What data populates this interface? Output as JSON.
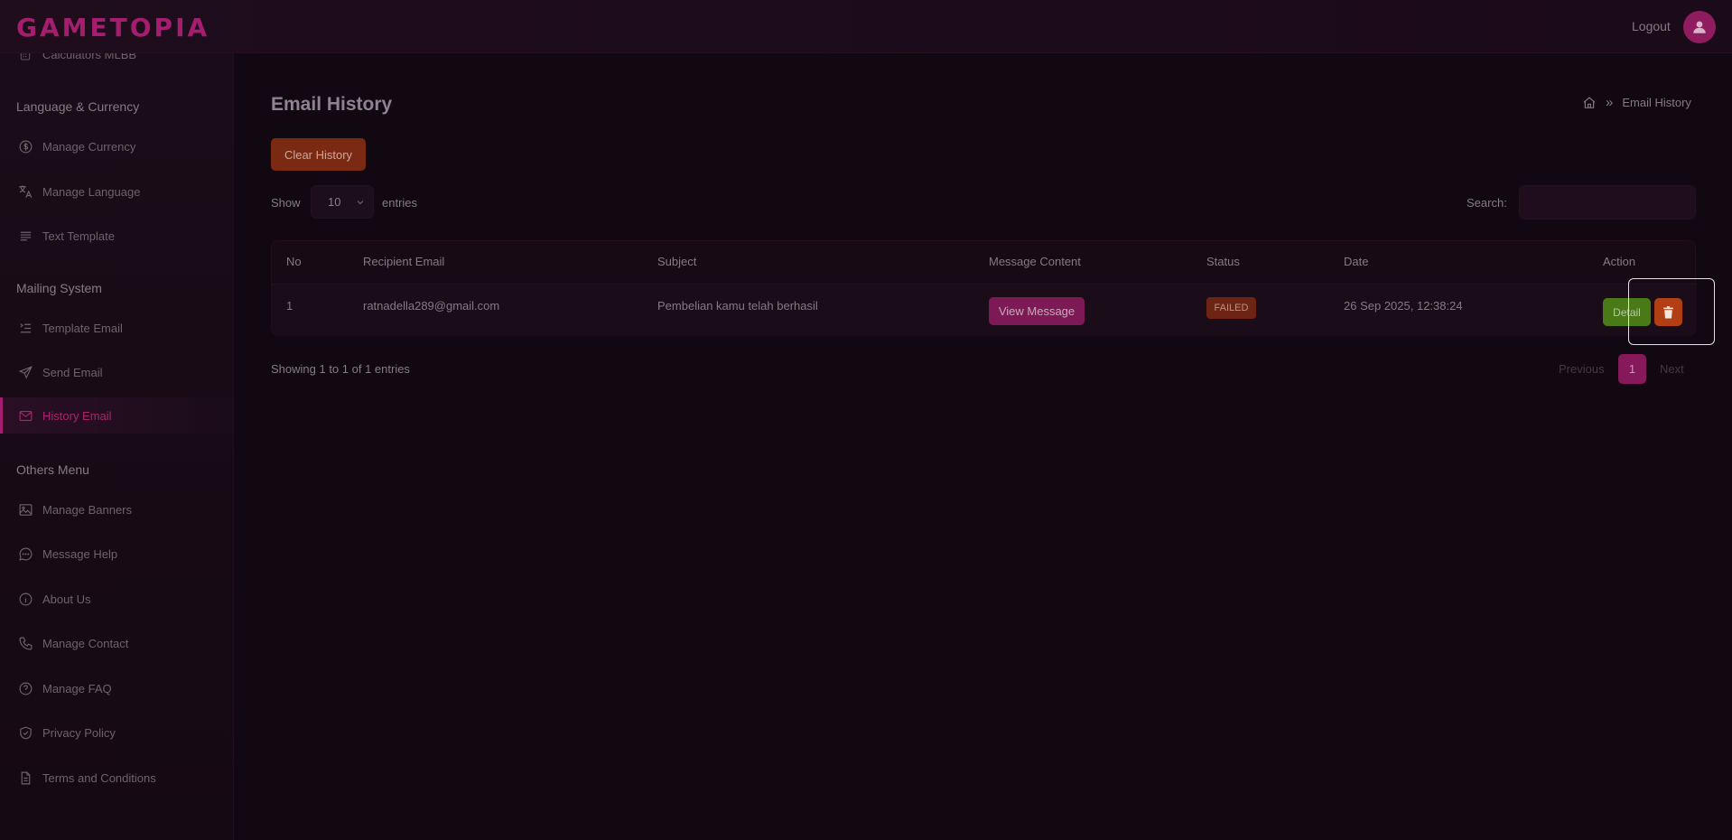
{
  "header": {
    "brand": "GAMETOPIA",
    "logout_label": "Logout"
  },
  "sidebar": {
    "partial_top_item": "Calculators MLBB",
    "sections": [
      {
        "title": "Language & Currency",
        "items": [
          {
            "label": "Manage Currency",
            "icon": "currency-icon"
          },
          {
            "label": "Manage Language",
            "icon": "translate-icon"
          },
          {
            "label": "Text Template",
            "icon": "text-lines-icon"
          }
        ]
      },
      {
        "title": "Mailing System",
        "items": [
          {
            "label": "Template Email",
            "icon": "list-indent-icon"
          },
          {
            "label": "Send Email",
            "icon": "send-icon"
          },
          {
            "label": "History Email",
            "icon": "mail-icon",
            "active": true
          }
        ]
      },
      {
        "title": "Others Menu",
        "items": [
          {
            "label": "Manage Banners",
            "icon": "image-icon"
          },
          {
            "label": "Message Help",
            "icon": "chat-icon"
          },
          {
            "label": "About Us",
            "icon": "info-icon"
          },
          {
            "label": "Manage Contact",
            "icon": "phone-icon"
          },
          {
            "label": "Manage FAQ",
            "icon": "question-icon"
          },
          {
            "label": "Privacy Policy",
            "icon": "shield-check-icon"
          },
          {
            "label": "Terms and Conditions",
            "icon": "document-icon"
          }
        ]
      }
    ]
  },
  "main": {
    "title": "Email History",
    "breadcrumb": {
      "current": "Email History",
      "separator": "»"
    },
    "clear_button": "Clear History",
    "length": {
      "show": "Show",
      "value": "10",
      "entries": "entries"
    },
    "search": {
      "label": "Search:",
      "value": ""
    },
    "table": {
      "columns": [
        "No",
        "Recipient Email",
        "Subject",
        "Message Content",
        "Status",
        "Date",
        "Action"
      ],
      "rows": [
        {
          "no": "1",
          "email": "ratnadella289@gmail.com",
          "subject": "Pembelian kamu telah berhasil",
          "message_button": "View Message",
          "status": "FAILED",
          "date": "26 Sep 2025, 12:38:24",
          "detail_button": "Detail"
        }
      ]
    },
    "info": "Showing 1 to 1 of 1 entries",
    "pagination": {
      "previous": "Previous",
      "current": "1",
      "next": "Next"
    }
  },
  "colors": {
    "accent": "#a41d6e",
    "background": "#120811",
    "danger": "#b23f14",
    "success": "#4a7a17"
  }
}
